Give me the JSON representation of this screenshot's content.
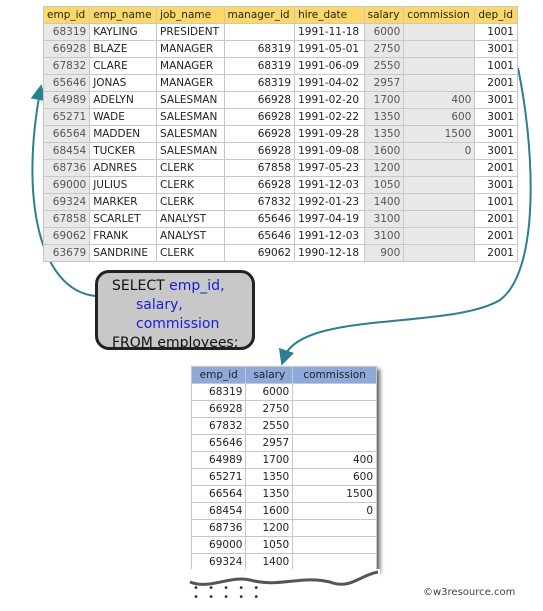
{
  "source_table": {
    "headers": [
      "emp_id",
      "emp_name",
      "job_name",
      "manager_id",
      "hire_date",
      "salary",
      "commission",
      "dep_id"
    ],
    "rows": [
      [
        "68319",
        "KAYLING",
        "PRESIDENT",
        "",
        "1991-11-18",
        "6000",
        "",
        "1001"
      ],
      [
        "66928",
        "BLAZE",
        "MANAGER",
        "68319",
        "1991-05-01",
        "2750",
        "",
        "3001"
      ],
      [
        "67832",
        "CLARE",
        "MANAGER",
        "68319",
        "1991-06-09",
        "2550",
        "",
        "1001"
      ],
      [
        "65646",
        "JONAS",
        "MANAGER",
        "68319",
        "1991-04-02",
        "2957",
        "",
        "2001"
      ],
      [
        "64989",
        "ADELYN",
        "SALESMAN",
        "66928",
        "1991-02-20",
        "1700",
        "400",
        "3001"
      ],
      [
        "65271",
        "WADE",
        "SALESMAN",
        "66928",
        "1991-02-22",
        "1350",
        "600",
        "3001"
      ],
      [
        "66564",
        "MADDEN",
        "SALESMAN",
        "66928",
        "1991-09-28",
        "1350",
        "1500",
        "3001"
      ],
      [
        "68454",
        "TUCKER",
        "SALESMAN",
        "66928",
        "1991-09-08",
        "1600",
        "0",
        "3001"
      ],
      [
        "68736",
        "ADNRES",
        "CLERK",
        "67858",
        "1997-05-23",
        "1200",
        "",
        "2001"
      ],
      [
        "69000",
        "JULIUS",
        "CLERK",
        "66928",
        "1991-12-03",
        "1050",
        "",
        "3001"
      ],
      [
        "69324",
        "MARKER",
        "CLERK",
        "67832",
        "1992-01-23",
        "1400",
        "",
        "1001"
      ],
      [
        "67858",
        "SCARLET",
        "ANALYST",
        "65646",
        "1997-04-19",
        "3100",
        "",
        "2001"
      ],
      [
        "69062",
        "FRANK",
        "ANALYST",
        "65646",
        "1991-12-03",
        "3100",
        "",
        "2001"
      ],
      [
        "63679",
        "SANDRINE",
        "CLERK",
        "69062",
        "1990-12-18",
        "900",
        "",
        "2001"
      ]
    ]
  },
  "sql": {
    "l1a": "SELECT ",
    "l1b": "emp_id,",
    "l2": "salary,",
    "l3": "commission",
    "l4": "FROM employees;"
  },
  "result_table": {
    "headers": [
      "emp_id",
      "salary",
      "commission"
    ],
    "rows": [
      [
        "68319",
        "6000",
        ""
      ],
      [
        "66928",
        "2750",
        ""
      ],
      [
        "67832",
        "2550",
        ""
      ],
      [
        "65646",
        "2957",
        ""
      ],
      [
        "64989",
        "1700",
        "400"
      ],
      [
        "65271",
        "1350",
        "600"
      ],
      [
        "66564",
        "1350",
        "1500"
      ],
      [
        "68454",
        "1600",
        "0"
      ],
      [
        "68736",
        "1200",
        ""
      ],
      [
        "69000",
        "1050",
        ""
      ],
      [
        "69324",
        "1400",
        ""
      ]
    ]
  },
  "ellipsis": "• • • • •",
  "copyright": "©w3resource.com",
  "colors": {
    "header": "#fcd966",
    "result_header": "#8eaadb",
    "arrow": "#2a7f91",
    "keyword_highlight": "#1a1adc"
  }
}
